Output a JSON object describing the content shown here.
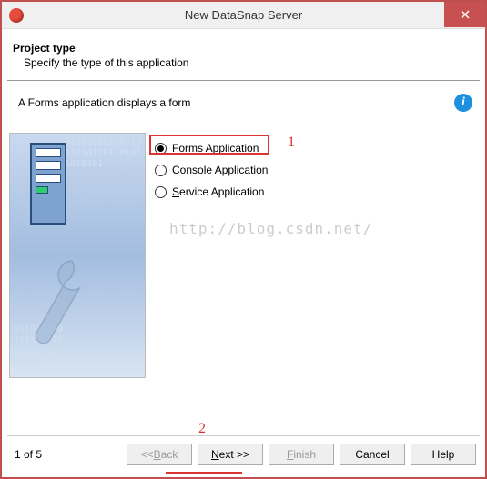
{
  "window": {
    "title": "New DataSnap Server"
  },
  "header": {
    "title": "Project type",
    "subtitle": "Specify the type of this application"
  },
  "description": "A Forms application displays a form",
  "options": {
    "forms": "Forms Application",
    "console": "Console Application",
    "service": "Service Application",
    "selected": "forms"
  },
  "annotations": {
    "num1": "1",
    "num2": "2"
  },
  "watermark": "http://blog.csdn.net/",
  "footer": {
    "page": "1 of 5",
    "back": "<< Back",
    "next": "Next >>",
    "finish": "Finish",
    "cancel": "Cancel",
    "help": "Help"
  }
}
